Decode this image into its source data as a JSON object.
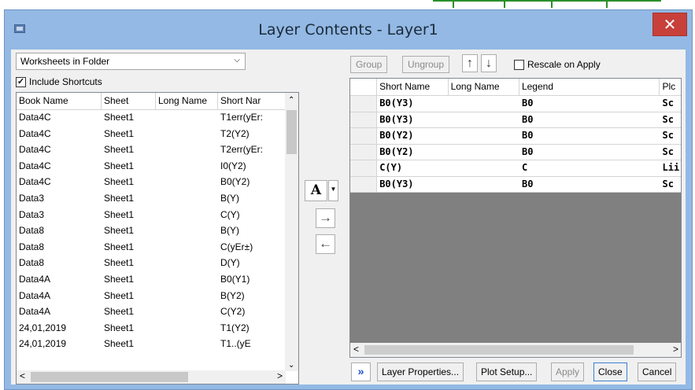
{
  "window": {
    "title": "Layer Contents - Layer1",
    "close_glyph": "✕"
  },
  "left": {
    "source_select": "Worksheets in Folder",
    "include_shortcuts_label": "Include Shortcuts",
    "include_shortcuts_checked": true,
    "columns": [
      "Book Name",
      "Sheet",
      "Long Name",
      "Short Nar"
    ],
    "rows": [
      [
        "Data4C",
        "Sheet1",
        "",
        "T1err(yEr:"
      ],
      [
        "Data4C",
        "Sheet1",
        "",
        "T2(Y2)"
      ],
      [
        "Data4C",
        "Sheet1",
        "",
        "T2err(yEr:"
      ],
      [
        "Data4C",
        "Sheet1",
        "",
        "I0(Y2)"
      ],
      [
        "Data4C",
        "Sheet1",
        "",
        "B0(Y2)"
      ],
      [
        "Data3",
        "Sheet1",
        "",
        "B(Y)"
      ],
      [
        "Data3",
        "Sheet1",
        "",
        "C(Y)"
      ],
      [
        "Data8",
        "Sheet1",
        "",
        "B(Y)"
      ],
      [
        "Data8",
        "Sheet1",
        "",
        "C(yEr±)"
      ],
      [
        "Data8",
        "Sheet1",
        "",
        "D(Y)"
      ],
      [
        "Data4A",
        "Sheet1",
        "",
        "B0(Y1)"
      ],
      [
        "Data4A",
        "Sheet1",
        "",
        "B(Y2)"
      ],
      [
        "Data4A",
        "Sheet1",
        "",
        "C(Y2)"
      ],
      [
        "24,01,2019",
        "Sheet1",
        "",
        "T1(Y2)"
      ],
      [
        "24,01,2019",
        "Sheet1",
        "",
        "T1..(yE"
      ]
    ]
  },
  "middle": {
    "font_button": "A",
    "add_arrow": "→",
    "remove_arrow": "←"
  },
  "right": {
    "group_label": "Group",
    "ungroup_label": "Ungroup",
    "move_up_glyph": "🡑",
    "move_down_glyph": "🡓",
    "rescale_label": "Rescale on Apply",
    "columns": [
      "",
      "Short Name",
      "Long Name",
      "Legend",
      "Plc"
    ],
    "rows": [
      [
        "",
        "B0(Y3)",
        "",
        "B0",
        "Sc"
      ],
      [
        "",
        "B0(Y3)",
        "",
        "B0",
        "Sc"
      ],
      [
        "",
        "B0(Y2)",
        "",
        "B0",
        "Sc"
      ],
      [
        "",
        "B0(Y2)",
        "",
        "B0",
        "Sc"
      ],
      [
        "",
        "C(Y)",
        "",
        "C",
        "Lii"
      ],
      [
        "",
        "B0(Y3)",
        "",
        "B0",
        "Sc"
      ]
    ]
  },
  "bottom": {
    "expand_glyph": "»",
    "layer_properties": "Layer Properties...",
    "plot_setup": "Plot Setup...",
    "apply": "Apply",
    "close": "Close",
    "cancel": "Cancel"
  }
}
